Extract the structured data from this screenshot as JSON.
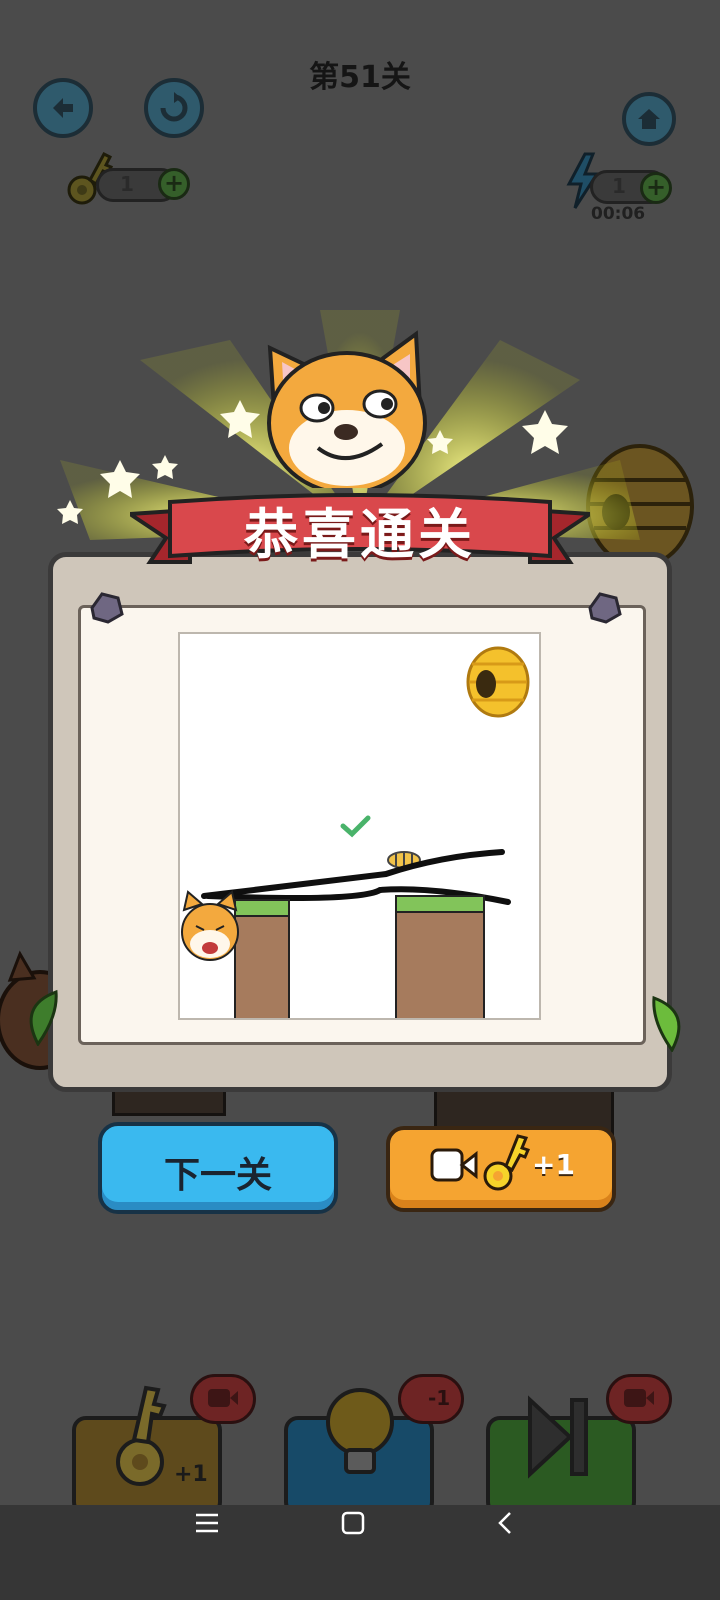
{
  "header": {
    "level_title": "第51关",
    "keys_count": "1",
    "energy_count": "1",
    "timer": "00:06"
  },
  "popup": {
    "banner": "恭喜通关",
    "next_label": "下一关",
    "video_reward_label": "+1"
  },
  "tools": {
    "key_label": "钥匙",
    "key_reward": "+1",
    "hint_label": "提示",
    "hint_cost": "-1",
    "skip_label": "跳过"
  },
  "colors": {
    "next_button": "#3ab9ef",
    "video_button": "#f5a431",
    "banner_ribbon": "#d9484c",
    "dog": "#f3a93e"
  }
}
